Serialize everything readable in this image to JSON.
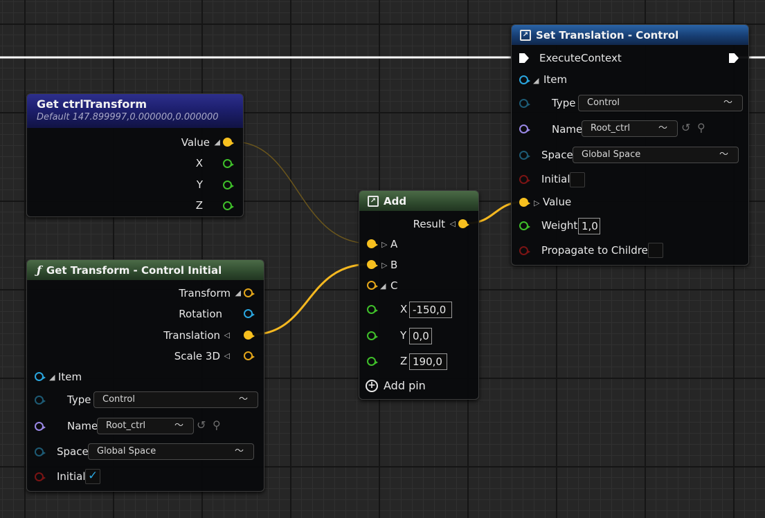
{
  "nodes": {
    "get_ctrl": {
      "title": "Get ctrlTransform",
      "subtitle": "Default 147.899997,0.000000,0.000000",
      "pins": {
        "value": "Value",
        "x": "X",
        "y": "Y",
        "z": "Z"
      }
    },
    "get_transform": {
      "title": "Get Transform - Control Initial",
      "pins": {
        "transform": "Transform",
        "rotation": "Rotation",
        "translation": "Translation",
        "scale": "Scale 3D"
      },
      "item_label": "Item",
      "type_label": "Type",
      "type_value": "Control",
      "name_label": "Name",
      "name_value": "Root_ctrl",
      "space_label": "Space",
      "space_value": "Global Space",
      "initial_label": "Initial",
      "initial_checked": true
    },
    "add": {
      "title": "Add",
      "result_label": "Result",
      "pin_a": "A",
      "pin_b": "B",
      "pin_c": "C",
      "x_label": "X",
      "x_value": "-150,0",
      "y_label": "Y",
      "y_value": "0,0",
      "z_label": "Z",
      "z_value": "190,0",
      "add_pin_label": "Add pin"
    },
    "set_translation": {
      "title": "Set Translation - Control",
      "execute_label": "ExecuteContext",
      "item_label": "Item",
      "type_label": "Type",
      "type_value": "Control",
      "name_label": "Name",
      "name_value": "Root_ctrl",
      "space_label": "Space",
      "space_value": "Global Space",
      "initial_label": "Initial",
      "value_label": "Value",
      "weight_label": "Weight",
      "weight_value": "1,0",
      "propagate_label": "Propagate to Children"
    }
  },
  "icons": {
    "function": "function-icon",
    "rig_unit": "rig-unit-icon",
    "chevron": "chevron-down-icon",
    "use_selected": "arrow-left-circle-icon",
    "browse": "search-icon",
    "checkmark": "checkmark-icon",
    "add_pin": "plus-circle-icon"
  },
  "colors": {
    "vector_pin": "#f7c01f",
    "float_pin": "#3fbf2a",
    "struct_pin": "#2aa5de",
    "name_pin": "#9a88e6",
    "bool_pin": "#7a1414",
    "wire_vector": "#f5b820",
    "wire_exec": "#ffffff"
  }
}
